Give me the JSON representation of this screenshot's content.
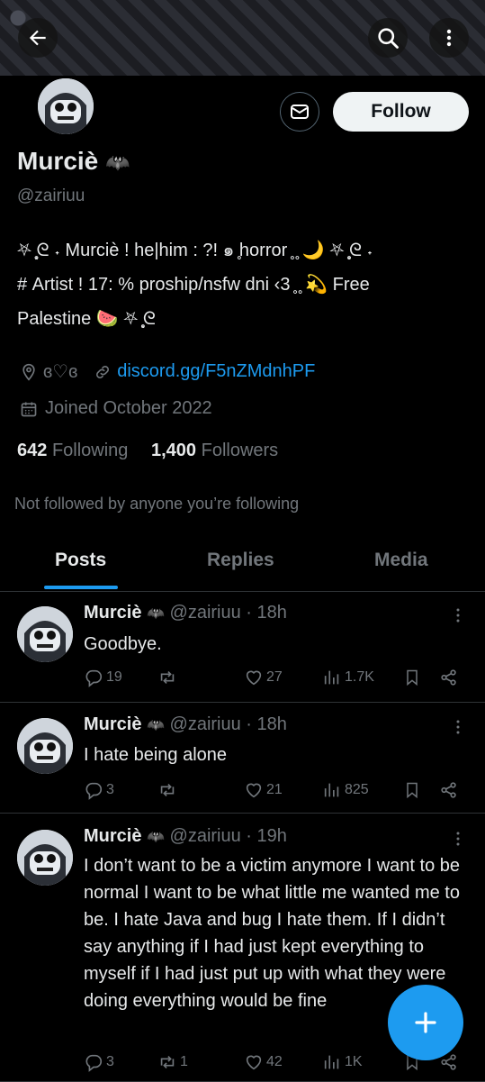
{
  "profile": {
    "name": "Murciè",
    "name_emoji": "🦇",
    "handle": "@zairiuu",
    "bio": "⛧ ̥͙ᘓ ˖ Murciè ! he|him : ?! ๑ ̥horror ̥ ̥ 🌙 ⛧ ̥͙ᘓ ˖\n# Artist ! 17: % proship/nsfw dni ‹3 ̥ ̥ 💫 Free\nPalestine 🍉 ⛧ ̥͙ᘓ",
    "location": "ɞ♡ɞ",
    "link": "discord.gg/F5nZMdnhPF",
    "joined": "Joined October 2022",
    "following_count": "642",
    "following_label": "Following",
    "followers_count": "1,400",
    "followers_label": "Followers",
    "not_followed": "Not followed by anyone you’re following",
    "follow_label": "Follow"
  },
  "tabs": [
    "Posts",
    "Replies",
    "Media"
  ],
  "posts": [
    {
      "name": "Murciè",
      "emoji": "🦇",
      "handle": "@zairiuu",
      "time": "· 18h",
      "text": "Goodbye.",
      "replies": "19",
      "reposts": "",
      "likes": "27",
      "views": "1.7K"
    },
    {
      "name": "Murciè",
      "emoji": "🦇",
      "handle": "@zairiuu",
      "time": "· 18h",
      "text": "I hate being alone",
      "replies": "3",
      "reposts": "",
      "likes": "21",
      "views": "825"
    },
    {
      "name": "Murciè",
      "emoji": "🦇",
      "handle": "@zairiuu",
      "time": "· 19h",
      "text": "I don’t want to be a victim anymore I want to be normal I want to be what little me wanted me to be. I hate Java and bug I hate them. If I didn’t say anything if I had just kept everything to myself if I had just put up with what they were doing everything would be fine",
      "replies": "3",
      "reposts": "1",
      "likes": "42",
      "views": "1K"
    }
  ],
  "icons": {
    "back": "back-arrow-icon",
    "search": "search-icon",
    "more": "more-vertical-icon",
    "mail": "mail-icon",
    "location": "location-icon",
    "link": "link-icon",
    "calendar": "calendar-icon",
    "compose": "plus-icon"
  },
  "colors": {
    "accent": "#1d9bf0",
    "muted": "#71767b",
    "text": "#e7e9ea",
    "background": "#000000"
  }
}
